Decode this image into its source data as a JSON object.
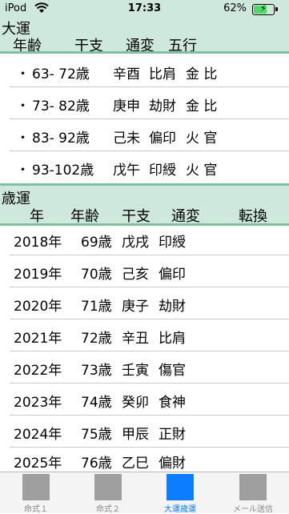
{
  "status_bar": {
    "carrier": "iPod",
    "time": "17:33",
    "battery": "62%",
    "battery_level": 0.62
  },
  "taiun": {
    "title": "大運",
    "columns": [
      "年齢",
      "干支",
      "通変",
      "五行"
    ],
    "rows": [
      {
        "bullet": "・",
        "age": "63- 72歳",
        "kanshi": "辛酉",
        "tsuhen": "比肩",
        "gogyo": "金 比"
      },
      {
        "bullet": "・",
        "age": "73- 82歳",
        "kanshi": "庚申",
        "tsuhen": "劫財",
        "gogyo": "金 比"
      },
      {
        "bullet": "・",
        "age": "83- 92歳",
        "kanshi": "己未",
        "tsuhen": "偏印",
        "gogyo": "火 官"
      },
      {
        "bullet": "・",
        "age": "93-102歳",
        "kanshi": "戊午",
        "tsuhen": "印綬",
        "gogyo": "火 官"
      }
    ]
  },
  "saiun": {
    "title": "歳運",
    "columns": [
      "年",
      "年齢",
      "干支",
      "通変",
      "転換"
    ],
    "rows": [
      {
        "year": "2018年",
        "age": "69歳",
        "kanshi": "戊戌",
        "tsuhen": "印綬"
      },
      {
        "year": "2019年",
        "age": "70歳",
        "kanshi": "己亥",
        "tsuhen": "偏印"
      },
      {
        "year": "2020年",
        "age": "71歳",
        "kanshi": "庚子",
        "tsuhen": "劫財"
      },
      {
        "year": "2021年",
        "age": "72歳",
        "kanshi": "辛丑",
        "tsuhen": "比肩"
      },
      {
        "year": "2022年",
        "age": "73歳",
        "kanshi": "壬寅",
        "tsuhen": "傷官"
      },
      {
        "year": "2023年",
        "age": "74歳",
        "kanshi": "癸卯",
        "tsuhen": "食神"
      },
      {
        "year": "2024年",
        "age": "75歳",
        "kanshi": "甲辰",
        "tsuhen": "正財"
      },
      {
        "year": "2025年",
        "age": "76歳",
        "kanshi": "乙巳",
        "tsuhen": "偏財"
      }
    ]
  },
  "tabs": [
    {
      "label": "命式１",
      "active": false
    },
    {
      "label": "命式２",
      "active": false
    },
    {
      "label": "大運歳運",
      "active": true
    },
    {
      "label": "メール送信",
      "active": false
    }
  ],
  "colors": {
    "header_bg": "#cfe8dc",
    "header_line": "#7fbfa3",
    "tab_active": "#0a7cff",
    "tab_inactive": "#9f9f9f"
  }
}
